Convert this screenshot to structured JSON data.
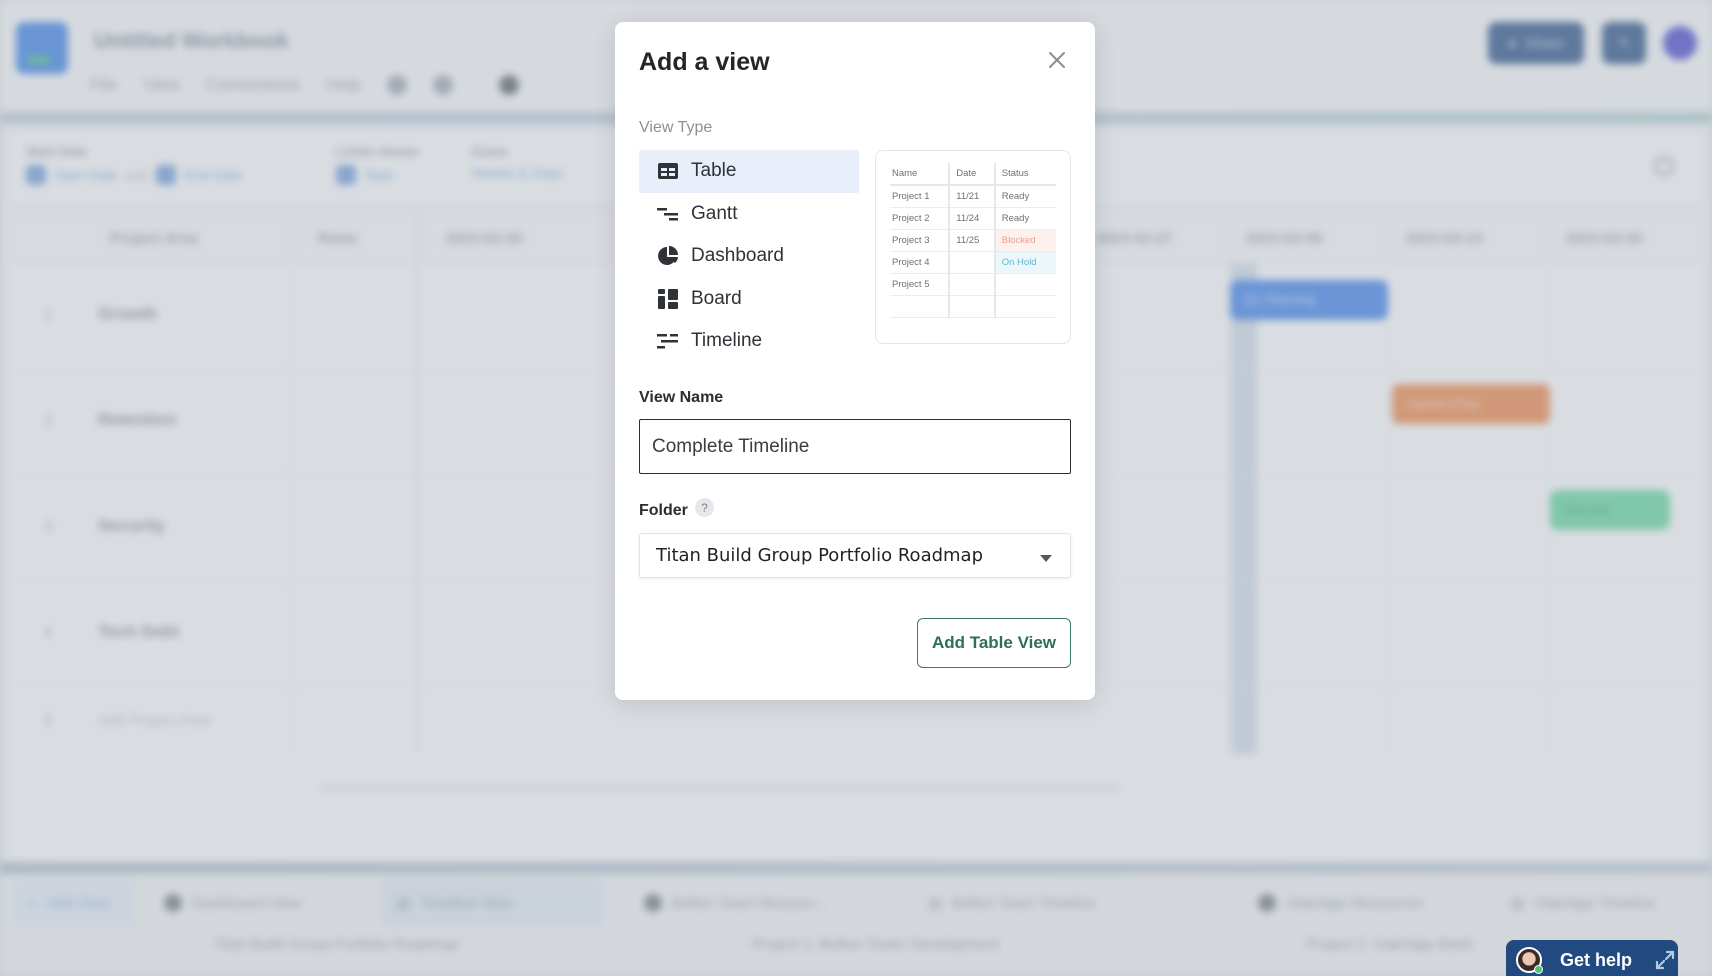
{
  "background": {
    "workbook_title": "Untitled Workbook",
    "menu": [
      "File",
      "View",
      "Connections",
      "Help"
    ],
    "header_buttons": {
      "share": "Share"
    },
    "filters": [
      {
        "label": "Start Date",
        "values": [
          "Start Date",
          "End Date"
        ],
        "joiner": "and"
      },
      {
        "label": "Limits shown",
        "values": [
          "Task"
        ]
      },
      {
        "label": "Zoom",
        "values": [
          "Weeks & Days"
        ]
      }
    ],
    "grid": {
      "columns": [
        "Project Area",
        "Rows",
        "2023-02-20",
        "2023-02-27",
        "2023-03-06",
        "2023-03-13",
        "2023-03-20"
      ],
      "rows": [
        {
          "num": "1",
          "name": "Growth"
        },
        {
          "num": "2",
          "name": "Retention"
        },
        {
          "num": "3",
          "name": "Security"
        },
        {
          "num": "4",
          "name": "Tech Debt"
        }
      ],
      "add_row": {
        "num": "5",
        "label": "Add Project Area"
      },
      "bars": [
        {
          "label": "Q1 Planning",
          "color": "#3f7fe4"
        },
        {
          "label": "Launch Prep",
          "color": "#e3844c"
        },
        {
          "label": "Go-Live",
          "color": "#62cf9d"
        }
      ]
    },
    "view_tabs": [
      {
        "label": "Add View"
      },
      {
        "label": "Dashboard View"
      },
      {
        "label": "Timeline View",
        "active": true
      },
      {
        "label": "Bolton Team Resourc..."
      },
      {
        "label": "Bolton Team Timeline"
      },
      {
        "label": "Oakridge Resources"
      },
      {
        "label": "Oakridge Timeline"
      }
    ],
    "folders": [
      "Titan Build Group Portfolio Roadmap",
      "Project 1: Bolton Tower Development",
      "Project 2: Oakridge Bank"
    ]
  },
  "modal": {
    "title": "Add a view",
    "close_icon": "close-icon",
    "view_type_label": "View Type",
    "view_types": [
      {
        "label": "Table",
        "icon": "table-icon",
        "selected": true
      },
      {
        "label": "Gantt",
        "icon": "gantt-icon",
        "selected": false
      },
      {
        "label": "Dashboard",
        "icon": "pie-chart-icon",
        "selected": false
      },
      {
        "label": "Board",
        "icon": "board-icon",
        "selected": false
      },
      {
        "label": "Timeline",
        "icon": "timeline-icon",
        "selected": false
      }
    ],
    "preview": {
      "headers": [
        "Name",
        "Date",
        "Status"
      ],
      "rows": [
        [
          "Project 1",
          "11/21",
          "Ready"
        ],
        [
          "Project 2",
          "11/24",
          "Ready"
        ],
        [
          "Project 3",
          "11/25",
          "Blocked"
        ],
        [
          "Project 4",
          "",
          "On Hold"
        ],
        [
          "Project 5",
          "",
          ""
        ],
        [
          "",
          "",
          ""
        ]
      ],
      "status_colors": {
        "Blocked": "#ee9b8a",
        "On Hold": "#5fb5cf"
      }
    },
    "view_name_label": "View Name",
    "view_name_value": "Complete Timeline",
    "folder_label": "Folder",
    "folder_help": "?",
    "folder_value": "Titan Build Group Portfolio Roadmap",
    "submit_label": "Add Table View",
    "accent_color": "#2f6e5b"
  },
  "help_widget": {
    "label": "Get help"
  }
}
